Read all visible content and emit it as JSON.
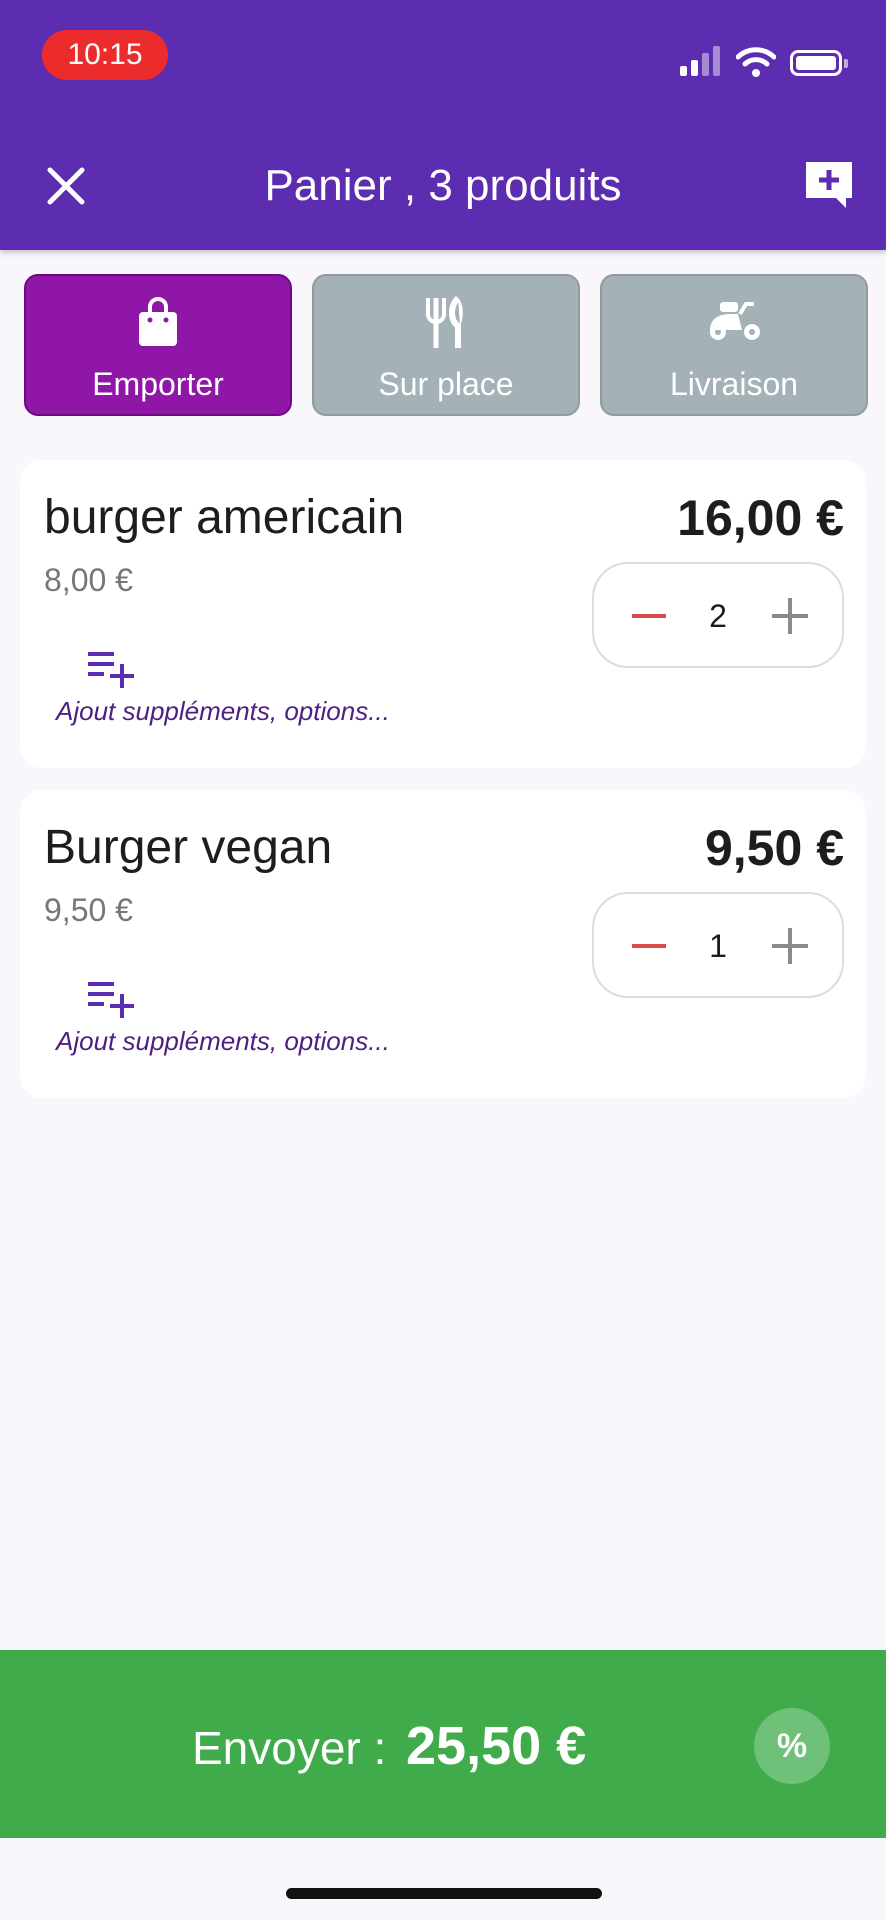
{
  "status_bar": {
    "time": "10:15"
  },
  "header": {
    "title": "Panier , 3 produits",
    "close_icon": "close-icon",
    "note_icon": "add-comment-icon"
  },
  "order_types": [
    {
      "label": "Emporter",
      "icon": "shopping-bag-icon",
      "active": true
    },
    {
      "label": "Sur place",
      "icon": "fork-knife-icon",
      "active": false
    },
    {
      "label": "Livraison",
      "icon": "scooter-icon",
      "active": false
    }
  ],
  "items": [
    {
      "name": "burger americain",
      "unit_price": "8,00 €",
      "total": "16,00 €",
      "quantity": "2",
      "options_label": "Ajout suppléments, options..."
    },
    {
      "name": "Burger vegan",
      "unit_price": "9,50 €",
      "total": "9,50 €",
      "quantity": "1",
      "options_label": "Ajout suppléments, options..."
    }
  ],
  "footer": {
    "send_label": "Envoyer  :",
    "total": "25,50 €",
    "discount_label": "%"
  },
  "colors": {
    "header": "#5c2db0",
    "active_tab": "#9016a8",
    "inactive_tab": "#a4b1b6",
    "send_bar": "#3fab4b",
    "minus": "#d94a4a"
  }
}
